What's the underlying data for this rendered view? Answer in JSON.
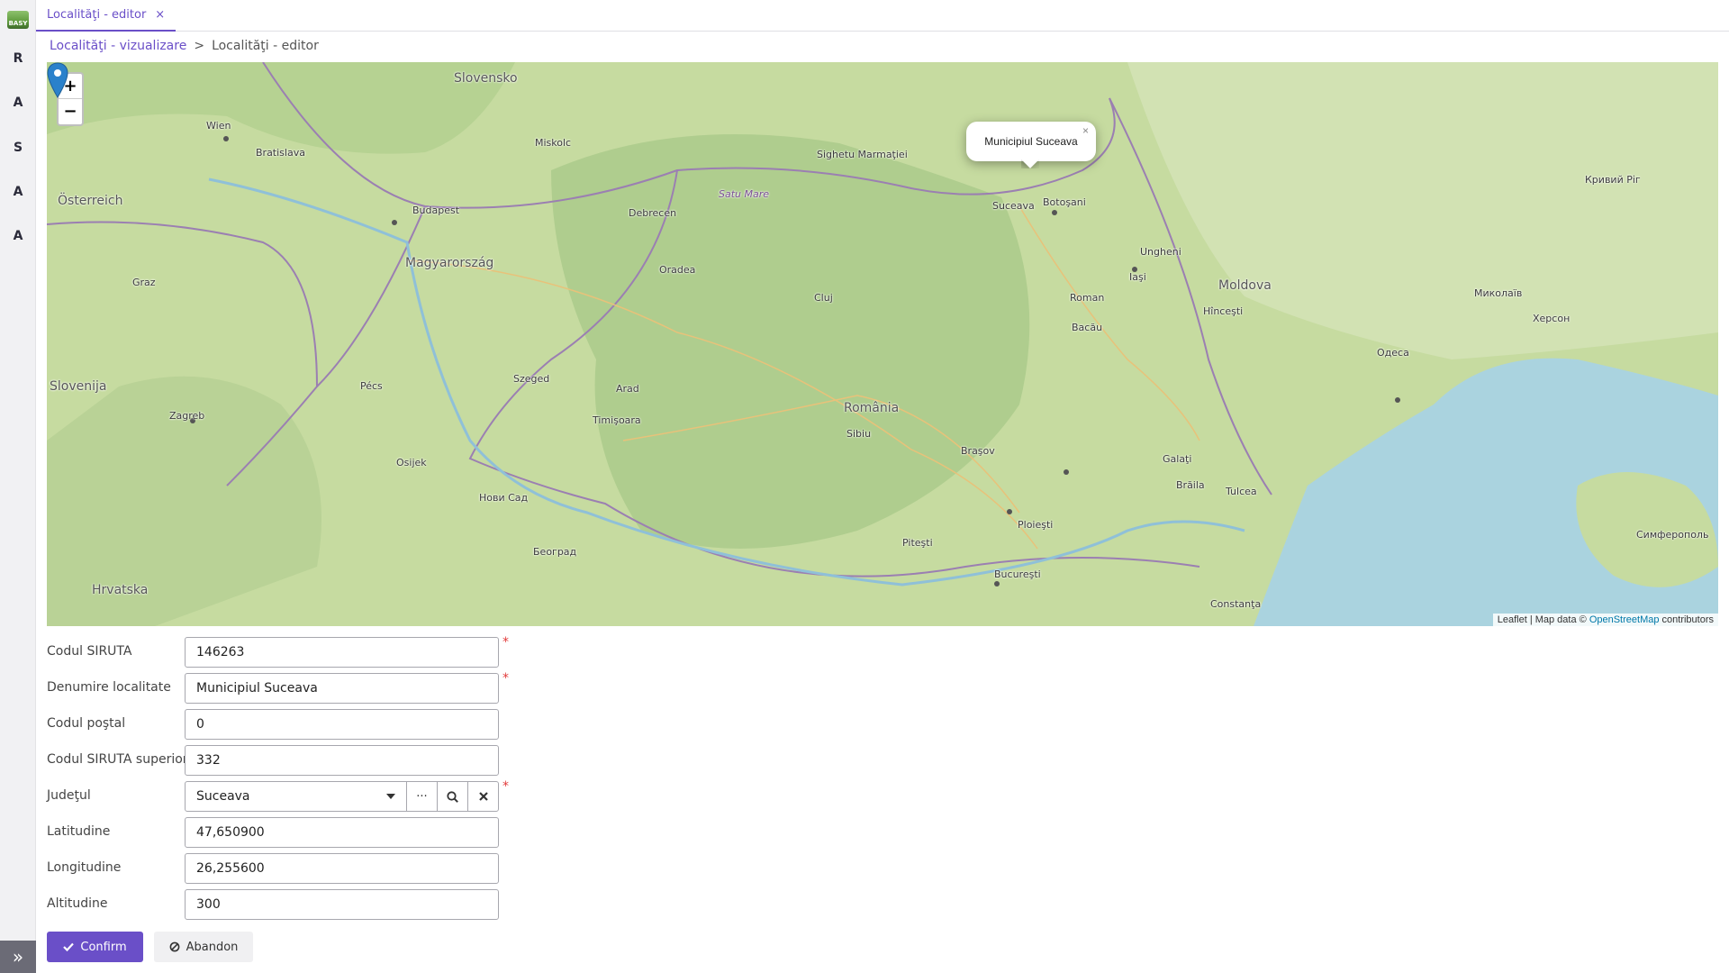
{
  "app": {
    "logo_text": "BASY"
  },
  "sidebar": {
    "letters": [
      "R",
      "A",
      "S",
      "A",
      "A"
    ],
    "expand_glyph": "»"
  },
  "tabs": [
    {
      "label": "Localităţi - editor",
      "close_glyph": "×"
    }
  ],
  "breadcrumb": {
    "parent": "Localităţi - vizualizare",
    "separator": ">",
    "current": "Localităţi - editor"
  },
  "map": {
    "zoom_in": "+",
    "zoom_out": "−",
    "popup_title": "Municipiul Suceava",
    "popup_close": "×",
    "attribution_prefix": "Leaflet | Map data © ",
    "attribution_link": "OpenStreetMap",
    "attribution_suffix": " contributors",
    "labels": {
      "slovensko": "Slovensko",
      "osterreich": "Österreich",
      "magyarorszag": "Magyarország",
      "slovenija": "Slovenija",
      "hrvatska": "Hrvatska",
      "romania": "România",
      "moldova": "Moldova",
      "wien": "Wien",
      "bratislava": "Bratislava",
      "budapest": "Budapest",
      "graz": "Graz",
      "zagreb": "Zagreb",
      "miskolc": "Miskolc",
      "debrecen": "Debrecen",
      "oradea": "Oradea",
      "cluj": "Cluj",
      "timisoara": "Timişoara",
      "arad": "Arad",
      "brasov": "Braşov",
      "bucuresti": "Bucureşti",
      "ploiesti": "Ploieşti",
      "galati": "Galaţi",
      "braila": "Brăila",
      "iasi": "Iaşi",
      "suceava": "Suceava",
      "botosani": "Botoşani",
      "bacau": "Bacău",
      "roman": "Roman",
      "sibiu": "Sibiu",
      "pitesti": "Piteşti",
      "constanta": "Constanţa",
      "tulcea": "Tulcea",
      "odesa": "Одеса",
      "mykolaiv": "Миколаїв",
      "kherson": "Херсон",
      "kryvyi": "Кривий Ріг",
      "simferopol": "Симферополь",
      "beograd": "Београд",
      "novi_sad": "Нови Сад",
      "szeged": "Szeged",
      "pecs": "Pécs",
      "osijek": "Osijek",
      "kishinau": "Hînceşti",
      "sighetu": "Sighetu Marmaţiei",
      "baia": "Satu Mare",
      "chisinau": "Ungheni"
    }
  },
  "form": {
    "fields": [
      {
        "label": "Codul SIRUTA",
        "value": "146263",
        "required": true
      },
      {
        "label": "Denumire localitate",
        "value": "Municipiul Suceava",
        "required": true
      },
      {
        "label": "Codul poştal",
        "value": "0",
        "required": false
      },
      {
        "label": "Codul SIRUTA superior",
        "value": "332",
        "required": false
      },
      {
        "label": "Judeţul",
        "value": "Suceava",
        "required": true
      },
      {
        "label": "Latitudine",
        "value": "47,650900",
        "required": false
      },
      {
        "label": "Longitudine",
        "value": "26,255600",
        "required": false
      },
      {
        "label": "Altitudine",
        "value": "300",
        "required": false
      }
    ],
    "required_mark": "*",
    "select_more": "···"
  },
  "actions": {
    "confirm": "Confirm",
    "abandon": "Abandon"
  }
}
